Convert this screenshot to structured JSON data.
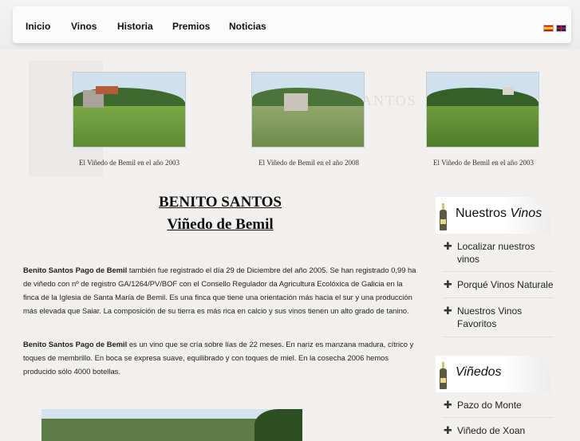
{
  "nav": {
    "items": [
      "Inicio",
      "Vinos",
      "Historia",
      "Premios",
      "Noticias"
    ]
  },
  "photos": [
    {
      "caption": "El Viñedo de Bemil en el año 2003"
    },
    {
      "caption": "El Viñedo de Bemil en el año 2008"
    },
    {
      "caption": "El Viñedo de Bemil en el año 2003"
    }
  ],
  "main": {
    "title1": "BENITO SANTOS",
    "title2": "Viñedo de Bemil",
    "para1_bold": "Benito Santos Pago de Bemil",
    "para1_text": " también fue registrado el día 29 de Diciembre del año 2005. Se han registrado 0,99 ha de viñedo con nº de registro GA/1264/PV/BOF con el Consello Regulador da Agricultura Ecolóxica de Galicia en la finca de la Iglesia de Santa María de Bemil. Es una finca que tiene una orientación más hacia el sur y una producción más elevada que Saiar. La composición de su tierra es más rica en calcio y sus vinos tienen un alto grado de tanino.",
    "para2_bold": "Benito Santos Pago de Bemil",
    "para2_text": " es un vino que se cría sobre lías de 22 meses. En nariz es manzana madura, cítrico y toques de membrillo. En boca se expresa suave, equilibrado y con toques de miel. En la cosecha 2006 hemos producido sólo 4000 botellas."
  },
  "sidebar": {
    "section1": {
      "title_plain": "Nuestros ",
      "title_italic": "Vinos"
    },
    "items1": [
      "Localizar nuestros vinos",
      "Porqué Vinos Naturale",
      "Nuestros Vinos Favoritos"
    ],
    "section2": {
      "title_plain": "",
      "title_italic": "Viñedos"
    },
    "items2": [
      "Pazo do Monte",
      "Viñedo de Xoan"
    ]
  },
  "watermark": {
    "text": "SANTOS"
  },
  "colors": {
    "background": "#f1f0ee",
    "accent_yellow": "#f6c14a"
  }
}
